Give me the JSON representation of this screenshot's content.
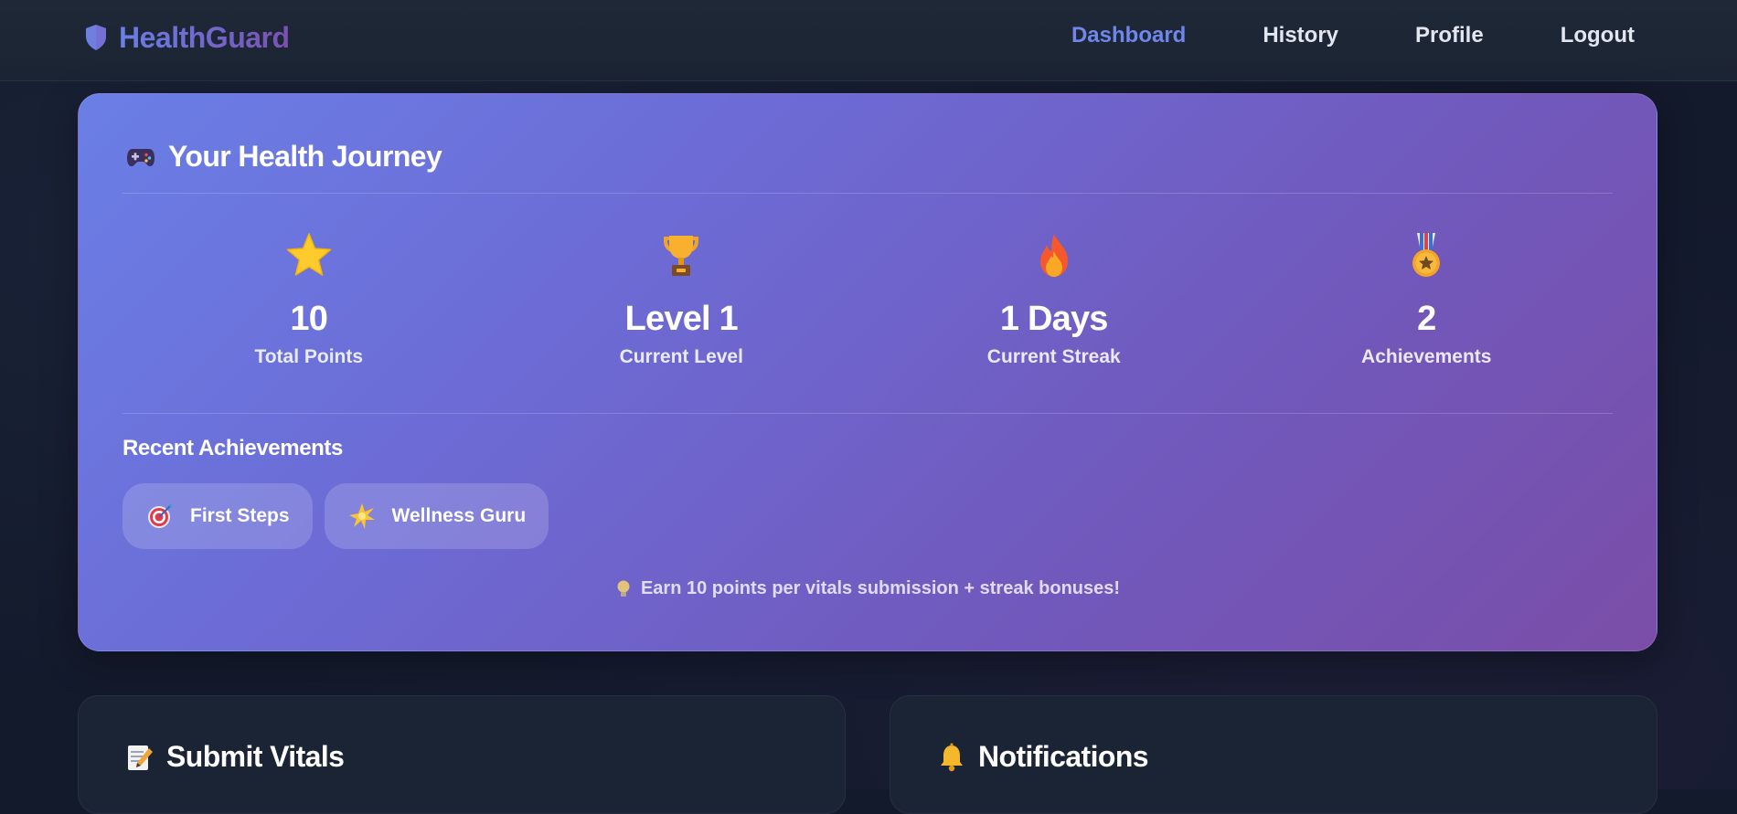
{
  "brand": {
    "name": "HealthGuard",
    "icon": "shield-icon"
  },
  "nav": {
    "links": [
      {
        "label": "Dashboard",
        "active": true
      },
      {
        "label": "History",
        "active": false
      },
      {
        "label": "Profile",
        "active": false
      },
      {
        "label": "Logout",
        "active": false
      }
    ]
  },
  "journey": {
    "title_emoji": "🎮",
    "title": "Your Health Journey",
    "stats": [
      {
        "icon": "star-icon",
        "value": "10",
        "label": "Total Points"
      },
      {
        "icon": "trophy-icon",
        "value": "Level 1",
        "label": "Current Level"
      },
      {
        "icon": "fire-icon",
        "value": "1 Days",
        "label": "Current Streak"
      },
      {
        "icon": "medal-icon",
        "value": "2",
        "label": "Achievements"
      }
    ],
    "recent_title": "Recent Achievements",
    "achievements": [
      {
        "icon": "target-icon",
        "label": "First Steps"
      },
      {
        "icon": "sparkle-star-icon",
        "label": "Wellness Guru"
      }
    ],
    "hint": "Earn 10 points per vitals submission + streak bonuses!",
    "hint_icon": "lightbulb-icon"
  },
  "cards": {
    "submit_vitals": {
      "icon": "memo-icon",
      "title": "Submit Vitals"
    },
    "notifications": {
      "icon": "bell-icon",
      "title": "Notifications"
    }
  },
  "colors": {
    "accent": "#6f86ea",
    "gradient_start": "#6a7fe6",
    "gradient_end": "#7a4ea8",
    "background": "#131a2c"
  }
}
